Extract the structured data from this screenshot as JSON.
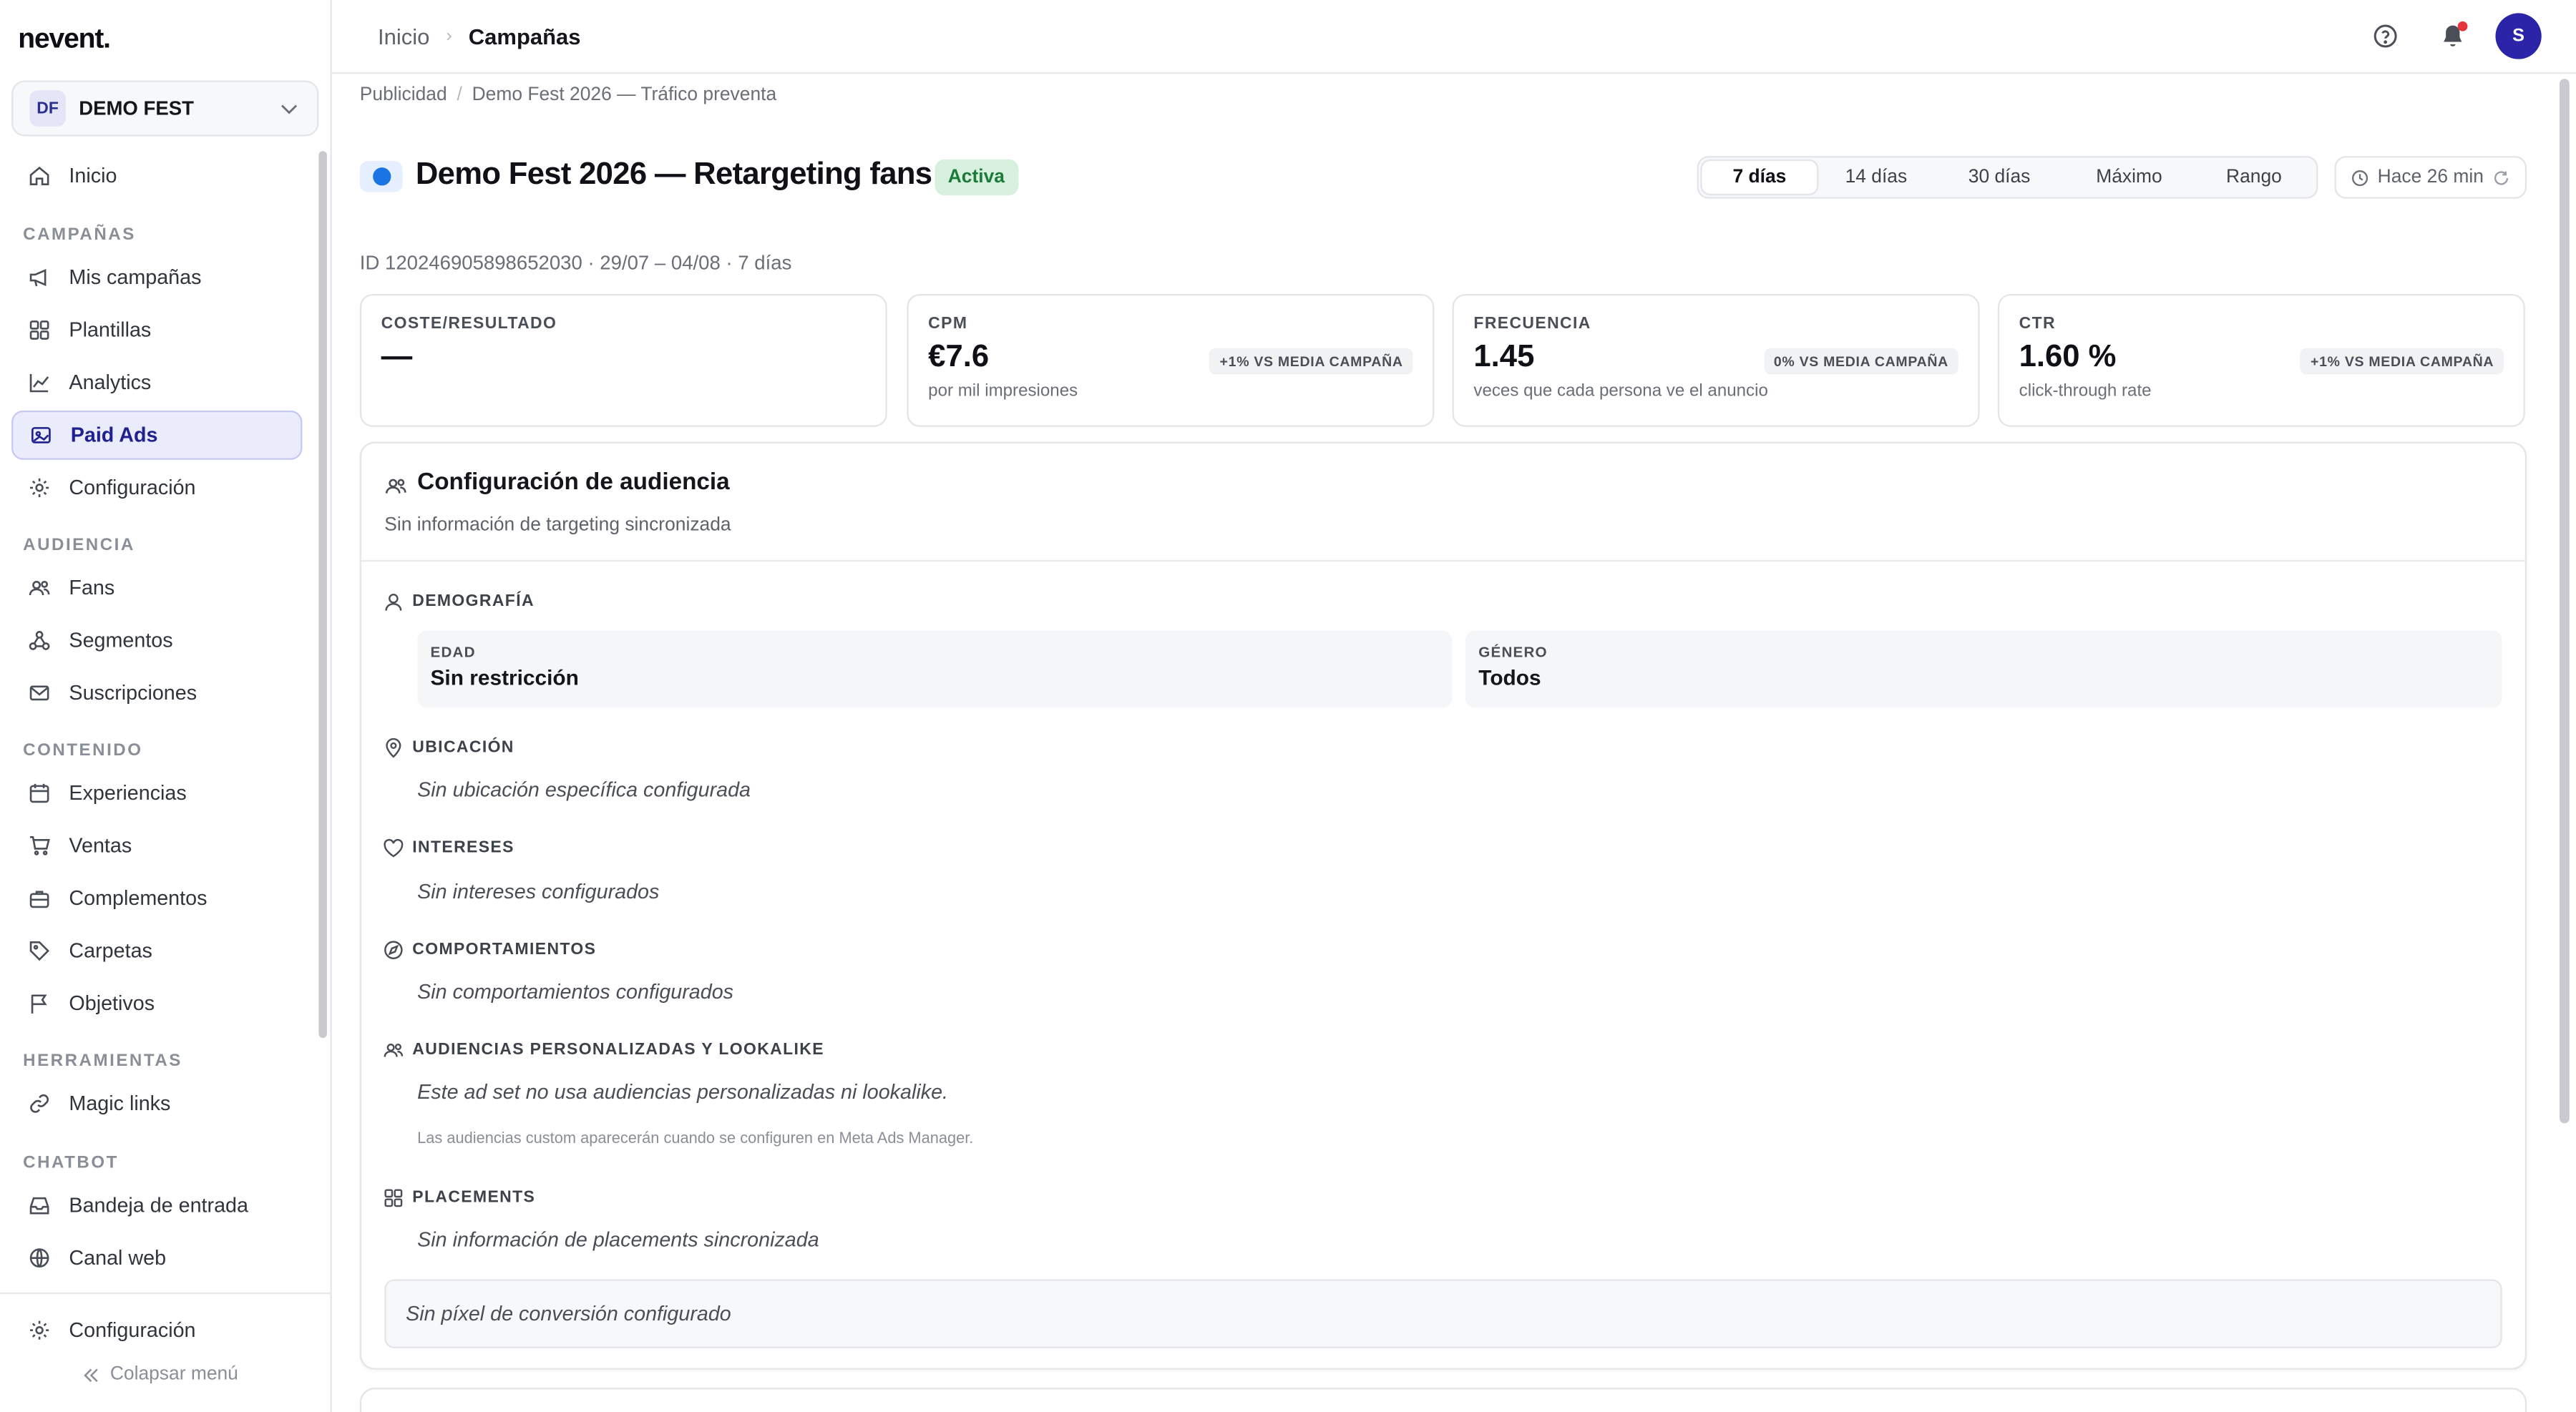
{
  "app": {
    "logo": "nevent."
  },
  "org": {
    "badge": "DF",
    "name": "DEMO FEST"
  },
  "sidebar": {
    "home": "Inicio",
    "sections": {
      "campaigns": "CAMPAÑAS",
      "audience": "AUDIENCIA",
      "content": "CONTENIDO",
      "tools": "HERRAMIENTAS",
      "chatbot": "CHATBOT"
    },
    "items": {
      "my_campaigns": "Mis campañas",
      "templates": "Plantillas",
      "analytics": "Analytics",
      "paid_ads": "Paid Ads",
      "campaign_config": "Configuración",
      "fans": "Fans",
      "segments": "Segmentos",
      "subscriptions": "Suscripciones",
      "experiences": "Experiencias",
      "sales": "Ventas",
      "addons": "Complementos",
      "folders": "Carpetas",
      "goals": "Objetivos",
      "magic_links": "Magic links",
      "inbox": "Bandeja de entrada",
      "web_channel": "Canal web"
    },
    "footer_config": "Configuración",
    "collapse": "Colapsar menú"
  },
  "topbar": {
    "crumb_home": "Inicio",
    "crumb_sep": "›",
    "crumb_current": "Campañas",
    "avatar": "S"
  },
  "page": {
    "subcrumb_root": "Publicidad",
    "subcrumb_sep": "/",
    "subcrumb_campaign": "Demo Fest 2026 — Tráfico preventa",
    "title": "Demo Fest 2026 — Retargeting fans",
    "status": "Activa",
    "periods": [
      "7 días",
      "14 días",
      "30 días",
      "Máximo",
      "Rango"
    ],
    "updated": "Hace 26 min",
    "meta": "ID 120246905898652030 · 29/07 – 04/08 · 7 días"
  },
  "kpis": [
    {
      "label": "COSTE/RESULTADO",
      "value": "—",
      "sub": "",
      "delta": ""
    },
    {
      "label": "CPM",
      "value": "€7.6",
      "sub": "por mil impresiones",
      "delta": "+1% VS MEDIA CAMPAÑA"
    },
    {
      "label": "FRECUENCIA",
      "value": "1.45",
      "sub": "veces que cada persona ve el anuncio",
      "delta": "0% VS MEDIA CAMPAÑA"
    },
    {
      "label": "CTR",
      "value": "1.60 %",
      "sub": "click-through rate",
      "delta": "+1% VS MEDIA CAMPAÑA"
    }
  ],
  "audience": {
    "title": "Configuración de audiencia",
    "subtitle": "Sin información de targeting sincronizada",
    "demography": {
      "label": "DEMOGRAFÍA",
      "age_label": "EDAD",
      "age_value": "Sin restricción",
      "gender_label": "GÉNERO",
      "gender_value": "Todos"
    },
    "location": {
      "label": "UBICACIÓN",
      "empty": "Sin ubicación específica configurada"
    },
    "interests": {
      "label": "INTERESES",
      "empty": "Sin intereses configurados"
    },
    "behaviors": {
      "label": "COMPORTAMIENTOS",
      "empty": "Sin comportamientos configurados"
    },
    "custom": {
      "label": "AUDIENCIAS PERSONALIZADAS Y LOOKALIKE",
      "empty": "Este ad set no usa audiencias personalizadas ni lookalike.",
      "note": "Las audiencias custom aparecerán cuando se configuren en Meta Ads Manager."
    },
    "placements": {
      "label": "PLACEMENTS",
      "empty": "Sin información de placements sincronizada"
    },
    "pixel": "Sin píxel de conversión configurado"
  },
  "colors": {
    "accent": "#2c24a8",
    "active_nav_bg": "#ebecfb",
    "status_bg": "#d7f1de",
    "status_text": "#1c7a3a",
    "facebook": "#1b74e4",
    "notification": "#e5343a"
  }
}
